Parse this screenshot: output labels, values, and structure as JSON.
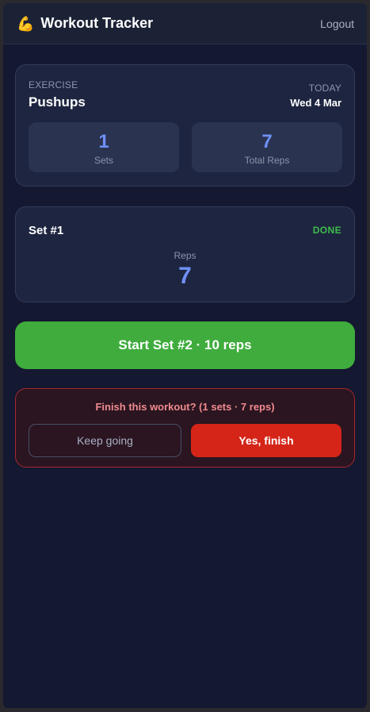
{
  "header": {
    "icon": "flexed-biceps-icon",
    "icon_glyph": "💪",
    "title": "Workout Tracker",
    "logout_label": "Logout"
  },
  "exercise": {
    "label": "EXERCISE",
    "name": "Pushups",
    "today_label": "TODAY",
    "date": "Wed 4 Mar",
    "stats": [
      {
        "value": "1",
        "label": "Sets"
      },
      {
        "value": "7",
        "label": "Total Reps"
      }
    ]
  },
  "set": {
    "title": "Set #1",
    "status": "DONE",
    "reps_label": "Reps",
    "reps_value": "7"
  },
  "start_button": {
    "label": "Start Set #2 · 10 reps"
  },
  "confirm": {
    "message": "Finish this workout? (1 sets · 7 reps)",
    "keep_label": "Keep going",
    "finish_label": "Yes, finish"
  },
  "colors": {
    "background": "#141830",
    "card": "#1e2540",
    "accent_blue": "#6f90f6",
    "success_green": "#3fac3d",
    "danger_red": "#d42518"
  }
}
